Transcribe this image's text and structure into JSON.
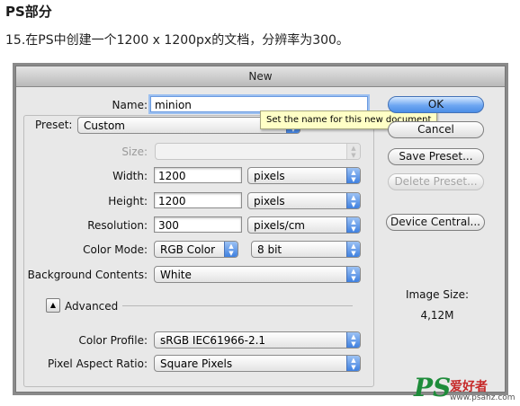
{
  "article": {
    "heading": "PS部分",
    "intro": "15.在PS中创建一个1200 x 1200px的文档，分辨率为300。"
  },
  "dialog": {
    "title": "New",
    "name": {
      "label": "Name:",
      "value": "minion"
    },
    "tooltip": "Set the name for this new document",
    "preset": {
      "label": "Preset:",
      "value": "Custom"
    },
    "size": {
      "label": "Size:",
      "value": ""
    },
    "width": {
      "label": "Width:",
      "value": "1200",
      "unit": "pixels"
    },
    "height": {
      "label": "Height:",
      "value": "1200",
      "unit": "pixels"
    },
    "resolution": {
      "label": "Resolution:",
      "value": "300",
      "unit": "pixels/cm"
    },
    "color_mode": {
      "label": "Color Mode:",
      "value": "RGB Color",
      "depth": "8 bit"
    },
    "background": {
      "label": "Background Contents:",
      "value": "White"
    },
    "advanced": {
      "label": "Advanced"
    },
    "color_profile": {
      "label": "Color Profile:",
      "value": "sRGB IEC61966-2.1"
    },
    "pixel_aspect": {
      "label": "Pixel Aspect Ratio:",
      "value": "Square Pixels"
    },
    "buttons": {
      "ok": "OK",
      "cancel": "Cancel",
      "save_preset": "Save Preset...",
      "delete_preset": "Delete Preset...",
      "device_central": "Device Central..."
    },
    "image_size": {
      "label": "Image Size:",
      "value": "4,12M"
    }
  },
  "watermark": {
    "ps": "PS",
    "cn": "爱好者",
    "url": "www.psahz.com"
  },
  "colors": {
    "accent": "#4b8de6",
    "tooltip_bg": "#ffffc6"
  },
  "icons": {
    "popup_arrows": "up-down-arrows-icon",
    "disclosure": "triangle-up-icon"
  }
}
